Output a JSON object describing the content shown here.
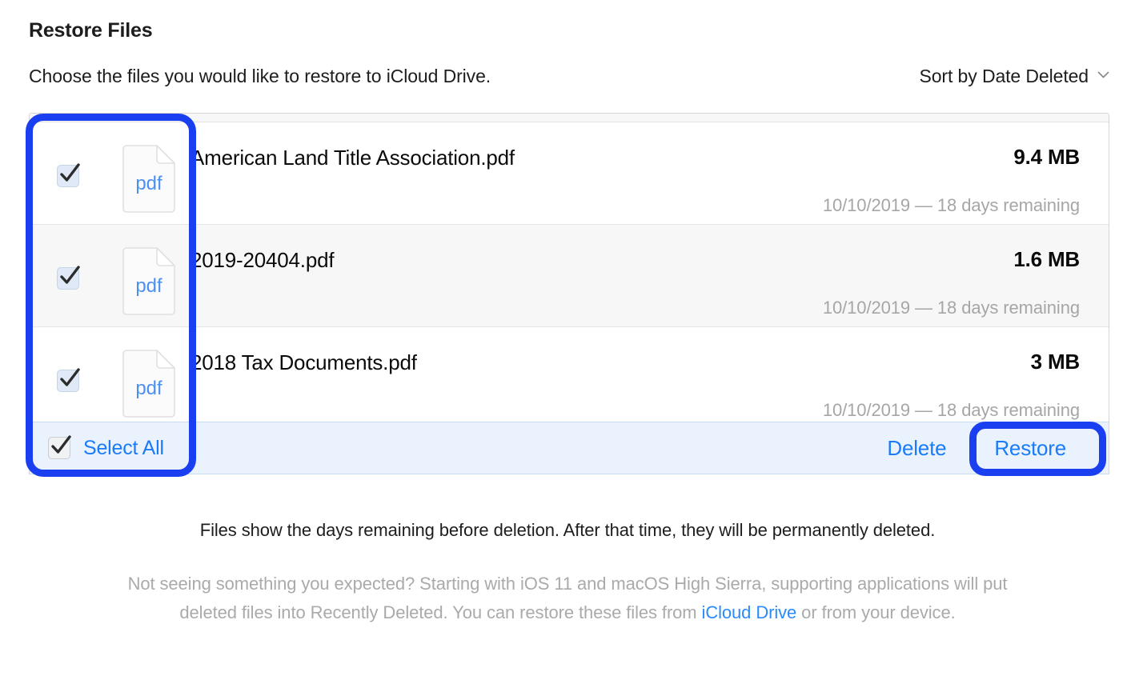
{
  "header": {
    "title": "Restore Files",
    "subtitle": "Choose the files you would like to restore to iCloud Drive.",
    "sort_label": "Sort by Date Deleted",
    "sort_icon": "chevron-down-icon"
  },
  "file_list": {
    "rows": [
      {
        "name": "American Land Title Association.pdf",
        "size": "9.4 MB",
        "date": "10/10/2019 — 18 days remaining",
        "file_type": "pdf",
        "checked": true
      },
      {
        "name": "2019-20404.pdf",
        "size": "1.6 MB",
        "date": "10/10/2019 — 18 days remaining",
        "file_type": "pdf",
        "checked": true
      },
      {
        "name": "2018 Tax Documents.pdf",
        "size": "3 MB",
        "date": "10/10/2019 — 18 days remaining",
        "file_type": "pdf",
        "checked": true
      }
    ]
  },
  "action_bar": {
    "select_all_label": "Select All",
    "select_all_checked": true,
    "delete_label": "Delete",
    "restore_label": "Restore"
  },
  "footer": {
    "note": "Files show the days remaining before deletion. After that time, they will be permanently deleted.",
    "help_prefix": "Not seeing something you expected? Starting with iOS 11 and macOS High Sierra, supporting applications will put deleted files into Recently Deleted. You can restore these files from ",
    "help_link": "iCloud Drive",
    "help_suffix": " or from your device."
  },
  "colors": {
    "accent_blue": "#1a7cf8",
    "link_blue": "#2b8bfb",
    "annotation_blue": "#1a3ff0",
    "action_bar_bg": "#eaf2fd",
    "row_alt_bg": "#f7f7f7",
    "muted_text": "#a6a6a6"
  }
}
